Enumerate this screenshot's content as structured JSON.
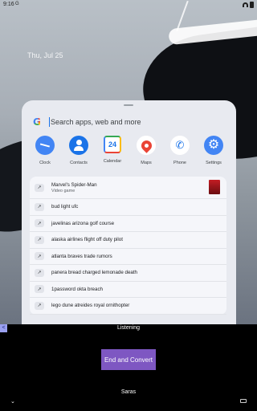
{
  "status_bar": {
    "time": "9:16",
    "notification": "G"
  },
  "home": {
    "date": "Thu, Jul 25"
  },
  "search": {
    "placeholder": "Search apps, web and more"
  },
  "apps": [
    {
      "label": "Clock",
      "icon": "clock-icon"
    },
    {
      "label": "Contacts",
      "icon": "contacts-icon"
    },
    {
      "label": "Calendar",
      "icon": "calendar-icon",
      "glyph": "24"
    },
    {
      "label": "Maps",
      "icon": "maps-icon"
    },
    {
      "label": "Phone",
      "icon": "phone-icon",
      "glyph": "✆"
    },
    {
      "label": "Settings",
      "icon": "settings-icon",
      "glyph": "⚙"
    }
  ],
  "suggestions": [
    {
      "text": "Marvel's Spider-Man",
      "subtitle": "Video game"
    },
    {
      "text": "bud light ufc"
    },
    {
      "text": "javelinas arizona golf course"
    },
    {
      "text": "alaska airlines flight off duty pilot"
    },
    {
      "text": "atlanta braves trade rumors"
    },
    {
      "text": "panera bread charged lemonade death"
    },
    {
      "text": "1password okta breach"
    },
    {
      "text": "lego dune atreides royal ornithopter"
    }
  ],
  "trend_icon": "↗",
  "overlay": {
    "status": "Listening",
    "button": "End and Convert",
    "user": "Saras",
    "left_tab": "<",
    "nav_down": "⌄"
  },
  "colors": {
    "accent": "#7e57c2",
    "google_blue": "#4285f4"
  }
}
